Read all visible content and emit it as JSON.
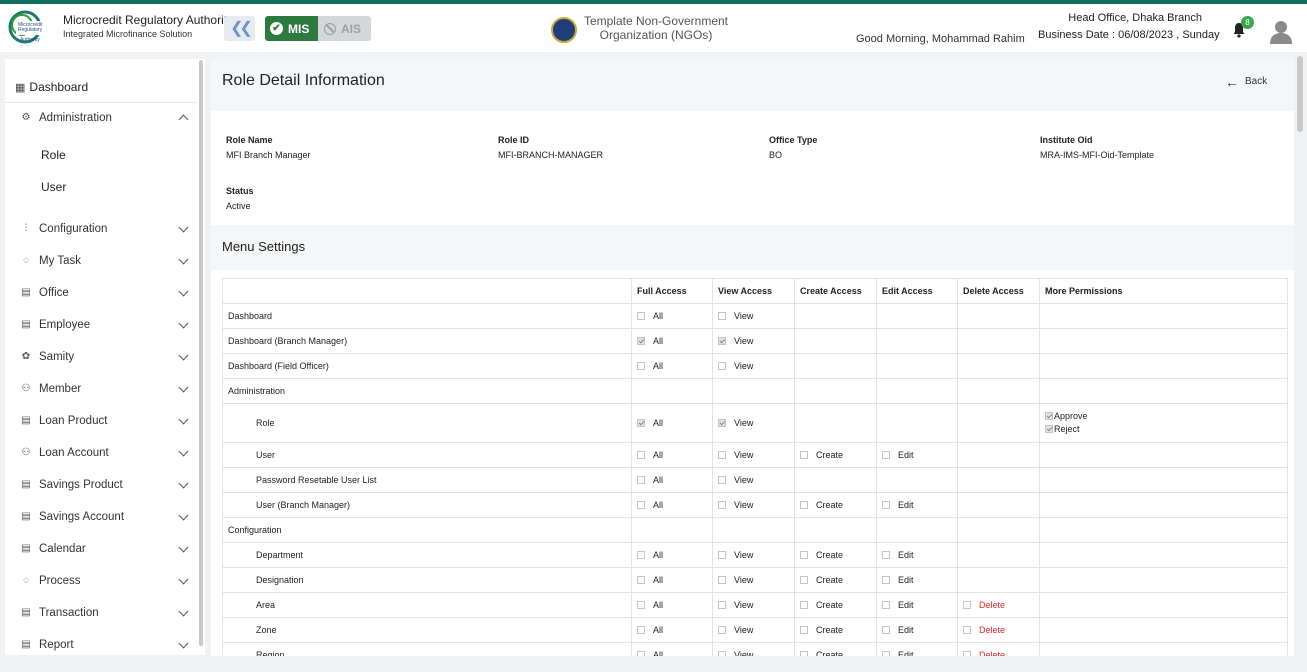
{
  "header": {
    "brand_title": "Microcredit Regulatory Authority",
    "brand_subtitle": "Integrated Microfinance Solution",
    "logo_text": "Microcredit Regulatory Authority",
    "mis_label": "MIS",
    "ais_label": "AIS",
    "org_name": "Template Non-Government Organization (NGOs)",
    "greeting": "Good Morning, Mohammad Rahim",
    "branch": "Head Office, Dhaka Branch",
    "business_date": "Business Date : 06/08/2023 , Sunday",
    "notification_count": "8",
    "accent_color": "#136d61"
  },
  "sidebar": {
    "dashboard": "Dashboard",
    "items": [
      {
        "label": "Administration",
        "icon": "admin-icon",
        "expanded": true
      },
      {
        "label": "Configuration",
        "icon": "sliders-icon"
      },
      {
        "label": "My Task",
        "icon": "task-icon"
      },
      {
        "label": "Office",
        "icon": "office-icon"
      },
      {
        "label": "Employee",
        "icon": "employee-icon"
      },
      {
        "label": "Samity",
        "icon": "samity-icon"
      },
      {
        "label": "Member",
        "icon": "member-icon"
      },
      {
        "label": "Loan Product",
        "icon": "loan-product-icon"
      },
      {
        "label": "Loan Account",
        "icon": "loan-account-icon"
      },
      {
        "label": "Savings Product",
        "icon": "savings-product-icon"
      },
      {
        "label": "Savings Account",
        "icon": "savings-account-icon"
      },
      {
        "label": "Calendar",
        "icon": "calendar-icon"
      },
      {
        "label": "Process",
        "icon": "process-icon"
      },
      {
        "label": "Transaction",
        "icon": "transaction-icon"
      },
      {
        "label": "Report",
        "icon": "report-icon"
      }
    ],
    "sub_items": [
      "Role",
      "User"
    ]
  },
  "page": {
    "title": "Role Detail Information",
    "back": "Back",
    "fields": {
      "role_name_label": "Role Name",
      "role_name": "MFI Branch Manager",
      "role_id_label": "Role ID",
      "role_id": "MFI-BRANCH-MANAGER",
      "office_type_label": "Office Type",
      "office_type": "BO",
      "institute_oid_label": "Institute Oid",
      "institute_oid": "MRA-IMS-MFI-Oid-Template",
      "status_label": "Status",
      "status": "Active"
    },
    "menu_title": "Menu Settings"
  },
  "table": {
    "headers": [
      "",
      "Full Access",
      "View Access",
      "Create Access",
      "Edit Access",
      "Delete Access",
      "More Permissions"
    ],
    "labels": {
      "all": "All",
      "view": "View",
      "create": "Create",
      "edit": "Edit",
      "delete": "Delete",
      "approve": "Approve",
      "reject": "Reject"
    },
    "rows": [
      {
        "name": "Dashboard",
        "sub": false,
        "full": "off",
        "view": "off",
        "create": null,
        "edit": null,
        "delete": null
      },
      {
        "name": "Dashboard (Branch Manager)",
        "sub": false,
        "full": "on",
        "view": "on",
        "create": null,
        "edit": null,
        "delete": null
      },
      {
        "name": "Dashboard (Field Officer)",
        "sub": false,
        "full": "off",
        "view": "off",
        "create": null,
        "edit": null,
        "delete": null
      },
      {
        "name": "Administration",
        "sub": false,
        "group": true
      },
      {
        "name": "Role",
        "sub": true,
        "full": "on",
        "view": "on",
        "create": null,
        "edit": null,
        "delete": null,
        "more": [
          "approve",
          "reject"
        ]
      },
      {
        "name": "User",
        "sub": true,
        "full": "off",
        "view": "off",
        "create": "off",
        "edit": "off",
        "delete": null
      },
      {
        "name": "Password Resetable User List",
        "sub": true,
        "full": "off",
        "view": "off",
        "create": null,
        "edit": null,
        "delete": null
      },
      {
        "name": "User (Branch Manager)",
        "sub": true,
        "full": "off",
        "view": "off",
        "create": "off",
        "edit": "off",
        "delete": null
      },
      {
        "name": "Configuration",
        "sub": false,
        "group": true
      },
      {
        "name": "Department",
        "sub": true,
        "full": "off",
        "view": "off",
        "create": "off",
        "edit": "off",
        "delete": null
      },
      {
        "name": "Designation",
        "sub": true,
        "full": "off",
        "view": "off",
        "create": "off",
        "edit": "off",
        "delete": null
      },
      {
        "name": "Area",
        "sub": true,
        "full": "off",
        "view": "off",
        "create": "off",
        "edit": "off",
        "delete": "off"
      },
      {
        "name": "Zone",
        "sub": true,
        "full": "off",
        "view": "off",
        "create": "off",
        "edit": "off",
        "delete": "off"
      },
      {
        "name": "Region",
        "sub": true,
        "full": "off",
        "view": "off",
        "create": "off",
        "edit": "off",
        "delete": "off"
      }
    ]
  }
}
